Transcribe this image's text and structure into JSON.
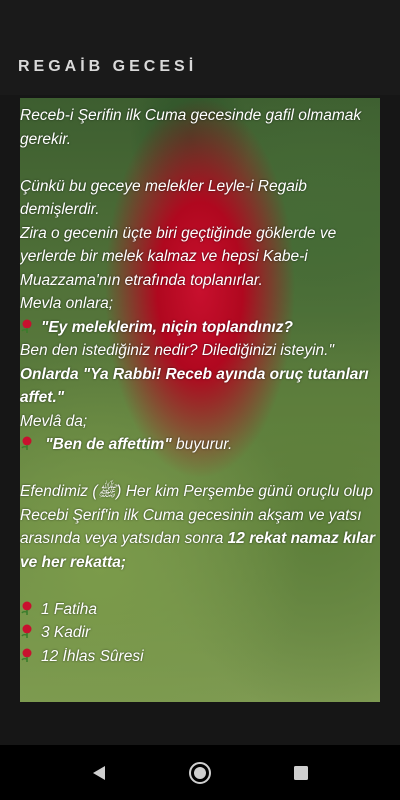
{
  "header": {
    "title": "REGAİB GECESİ"
  },
  "content": {
    "lines": [
      "Receb-i Şerifin ilk Cuma gecesinde gafil olmamak gerekir.",
      " Çünkü bu geceye melekler Leyle-i Regaib demişlerdir.",
      "Zira o gecenin üçte biri geçtiğinde göklerde ve yerlerde bir melek kalmaz ve hepsi Kabe-i Muazzama'nın etrafında toplanırlar.",
      "Mevla onlara;",
      "\"Ey meleklerim, niçin toplandınız?",
      "Ben den istediğiniz nedir? Dilediğinizi isteyin.\"",
      "Onlarda \"Ya Rabbi! Receb ayında oruç tutanları affet.\"",
      "Mevlâ da;",
      " \"Ben de affettim\"",
      " buyurur.",
      "Efendimiz (ﷺ) Her kim Perşembe günü oruçlu olup Recebi Şerif'in ilk Cuma gecesinin akşam ve yatsı arasında veya yatsıdan sonra ",
      "12 rekat namaz kılar ve her rekatta;",
      "1 Fatiha",
      "3 Kadir",
      "12 İhlas Sûresi"
    ]
  },
  "icons": {
    "bullet": "rose-icon"
  },
  "colors": {
    "rose": "#c8102e",
    "text": "#ffffff",
    "title": "#d9d9d9",
    "nav_bar": "#000000"
  },
  "nav": {
    "back": "back-triangle-icon",
    "home": "home-circle-icon",
    "recents": "recents-square-icon"
  }
}
